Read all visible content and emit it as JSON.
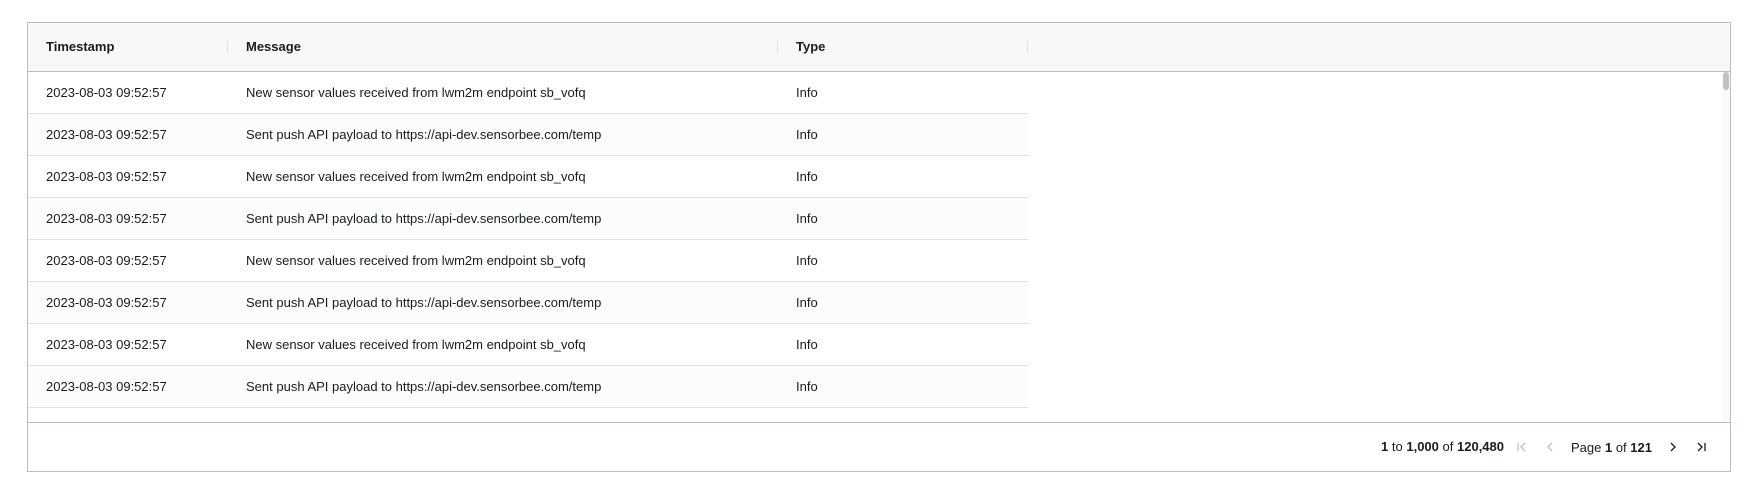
{
  "grid": {
    "columns": [
      {
        "label": "Timestamp"
      },
      {
        "label": "Message"
      },
      {
        "label": "Type"
      }
    ],
    "rows": [
      {
        "timestamp": "2023-08-03 09:52:57",
        "message": "New sensor values received from lwm2m endpoint sb_vofq",
        "type": "Info"
      },
      {
        "timestamp": "2023-08-03 09:52:57",
        "message": "Sent push API payload to https://api-dev.sensorbee.com/temp",
        "type": "Info"
      },
      {
        "timestamp": "2023-08-03 09:52:57",
        "message": "New sensor values received from lwm2m endpoint sb_vofq",
        "type": "Info"
      },
      {
        "timestamp": "2023-08-03 09:52:57",
        "message": "Sent push API payload to https://api-dev.sensorbee.com/temp",
        "type": "Info"
      },
      {
        "timestamp": "2023-08-03 09:52:57",
        "message": "New sensor values received from lwm2m endpoint sb_vofq",
        "type": "Info"
      },
      {
        "timestamp": "2023-08-03 09:52:57",
        "message": "Sent push API payload to https://api-dev.sensorbee.com/temp",
        "type": "Info"
      },
      {
        "timestamp": "2023-08-03 09:52:57",
        "message": "New sensor values received from lwm2m endpoint sb_vofq",
        "type": "Info"
      },
      {
        "timestamp": "2023-08-03 09:52:57",
        "message": "Sent push API payload to https://api-dev.sensorbee.com/temp",
        "type": "Info"
      }
    ]
  },
  "pagination": {
    "row_from": "1",
    "to_label": "to",
    "row_to": "1,000",
    "of_label": "of",
    "row_total": "120,480",
    "page_label": "Page",
    "page_current": "1",
    "page_of_label": "of",
    "page_total": "121",
    "icons": {
      "first": "first-page-icon",
      "previous": "previous-page-icon",
      "next": "next-page-icon",
      "last": "last-page-icon"
    }
  },
  "colors": {
    "border": "#babfc7",
    "header_bg": "#f8f8f8",
    "row_divider": "#dde2eb",
    "text": "#181d1f"
  }
}
